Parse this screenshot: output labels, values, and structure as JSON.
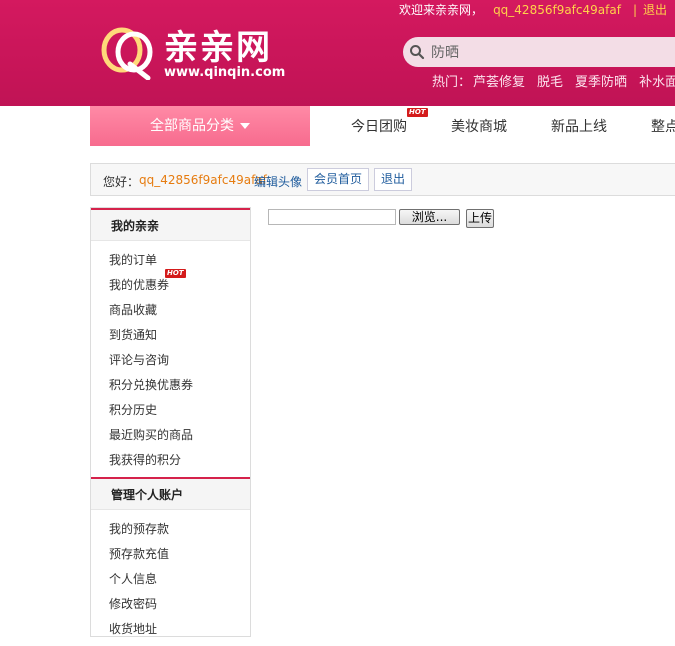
{
  "topbar": {
    "welcome": "欢迎来亲亲网，",
    "username": "qq_42856f9afc49afaf",
    "separator": "|",
    "logout": "退出"
  },
  "logo": {
    "name": "亲亲网",
    "url": "www.qinqin.com"
  },
  "search": {
    "value": "防晒",
    "hot_label": "热门：",
    "hot_words": [
      "芦荟修复",
      "脱毛",
      "夏季防晒",
      "补水面膜"
    ]
  },
  "nav": {
    "all_categories": "全部商品分类",
    "items": [
      "今日团购",
      "美妆商城",
      "新品上线",
      "整点"
    ],
    "hot_badge": "HOT"
  },
  "memberbar": {
    "hello": "您好：",
    "username": "qq_42856f9afc49afaf",
    "edit_avatar": "编辑头像",
    "member_home": "会员首页",
    "logout": "退出"
  },
  "sidebar": {
    "sections": [
      {
        "title": "我的亲亲",
        "items": [
          "我的订单",
          "我的优惠券",
          "商品收藏",
          "到货通知",
          "评论与咨询",
          "积分兑换优惠券",
          "积分历史",
          "最近购买的商品",
          "我获得的积分"
        ]
      },
      {
        "title": "管理个人账户",
        "items": [
          "我的预存款",
          "预存款充值",
          "个人信息",
          "修改密码",
          "收货地址"
        ]
      }
    ],
    "hot_badge": "HOT"
  },
  "upload": {
    "browse_label": "浏览...",
    "submit_label": "上传"
  },
  "colors": {
    "header_bg": "#c51457",
    "accent_yellow": "#ffd24a",
    "nav_pink": "#f76b8e",
    "link_blue": "#1e5b9c",
    "username_orange": "#e67c10",
    "section_red": "#d5224b"
  }
}
